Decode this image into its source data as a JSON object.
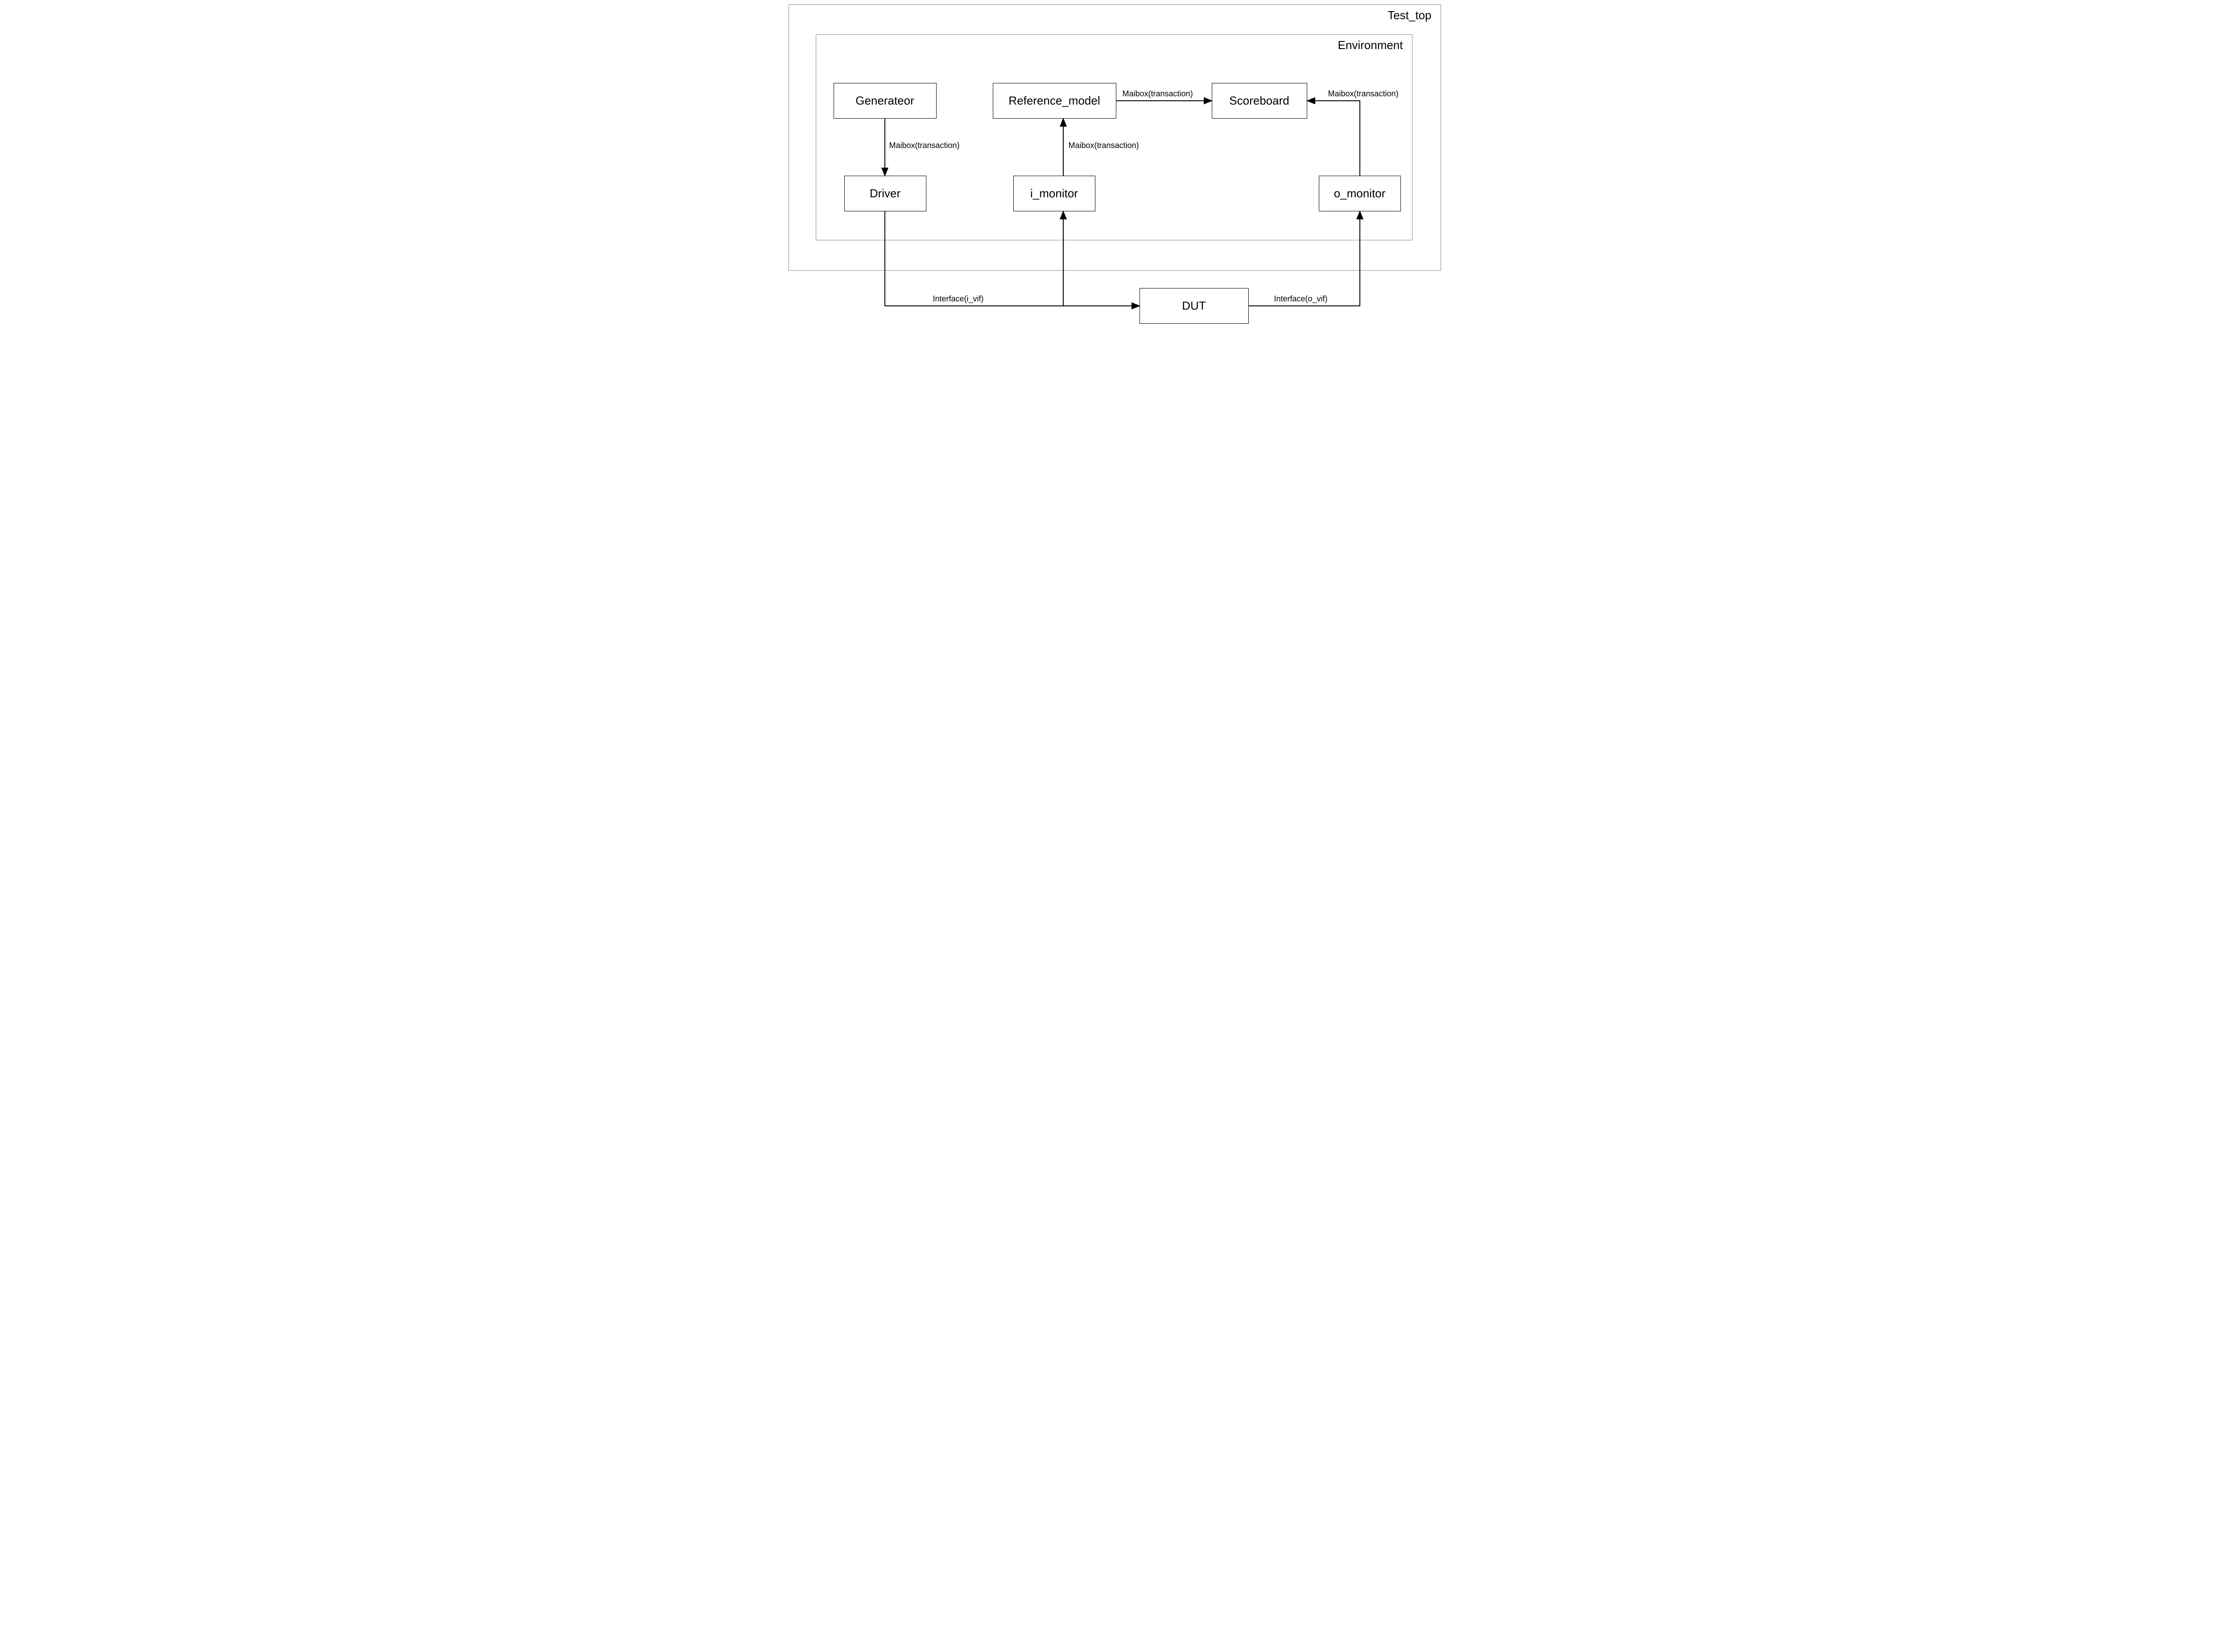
{
  "containers": {
    "test_top": {
      "label": "Test_top"
    },
    "environment": {
      "label": "Environment"
    }
  },
  "nodes": {
    "generator": {
      "label": "Generateor"
    },
    "driver": {
      "label": "Driver"
    },
    "reference_model": {
      "label": "Reference_model"
    },
    "i_monitor": {
      "label": "i_monitor"
    },
    "scoreboard": {
      "label": "Scoreboard"
    },
    "o_monitor": {
      "label": "o_monitor"
    },
    "dut": {
      "label": "DUT"
    }
  },
  "edges": {
    "gen_to_driver": {
      "label": "Maibox(transaction)"
    },
    "imon_to_ref": {
      "label": "Maibox(transaction)"
    },
    "ref_to_score": {
      "label": "Maibox(transaction)"
    },
    "omon_to_score": {
      "label": "Maibox(transaction)"
    },
    "driver_to_dut": {
      "label": "Interface(i_vif)"
    },
    "dut_to_omon": {
      "label": "Interface(o_vif)"
    }
  }
}
